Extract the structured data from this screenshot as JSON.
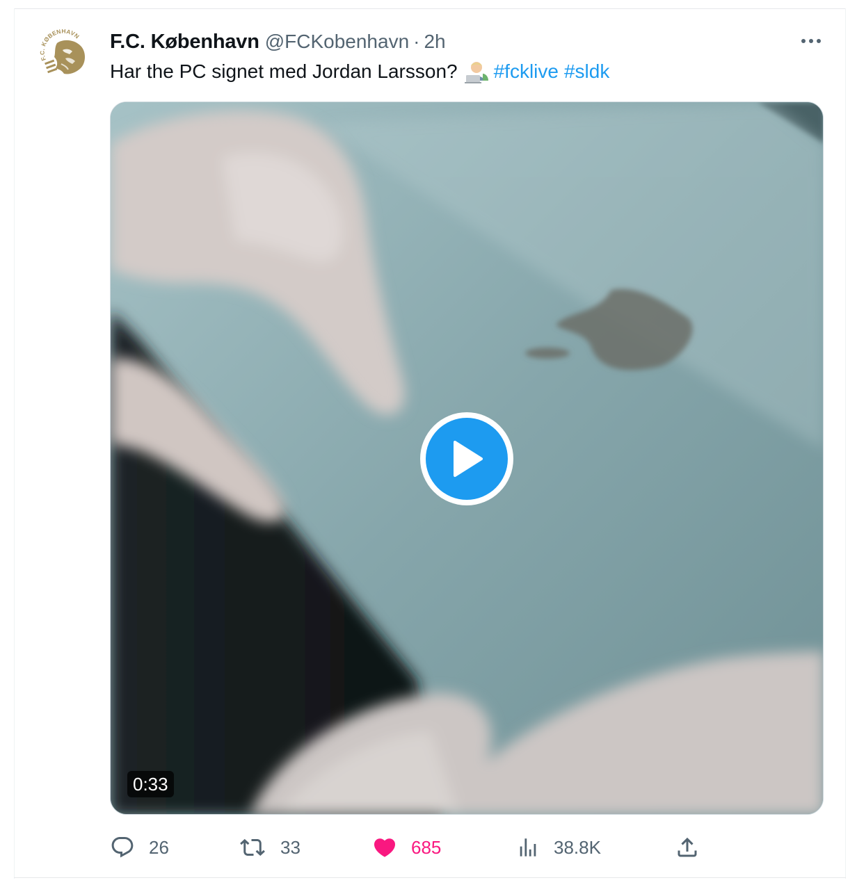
{
  "tweet": {
    "author_name": "F.C. København",
    "handle": "@FCKobenhavn",
    "separator": "·",
    "time": "2h",
    "text": "Har the PC signet med Jordan Larsson?",
    "emoji": "technologist-emoji",
    "hashtags": [
      "#fcklive",
      "#sldk"
    ],
    "avatar_logo_text": "F.C. KØBENHAVN",
    "more_icon": "more-icon"
  },
  "media": {
    "type": "video",
    "duration": "0:33",
    "play_icon": "play-icon"
  },
  "actions": {
    "replies": "26",
    "retweets": "33",
    "likes": "685",
    "views": "38.8K",
    "icons": [
      "reply-icon",
      "retweet-icon",
      "heart-icon",
      "views-icon",
      "share-icon"
    ]
  },
  "colors": {
    "link": "#1d9bf0",
    "like": "#f91880",
    "secondary_text": "#536471",
    "primary_text": "#0f1419",
    "logo_gold": "#a8915a"
  }
}
